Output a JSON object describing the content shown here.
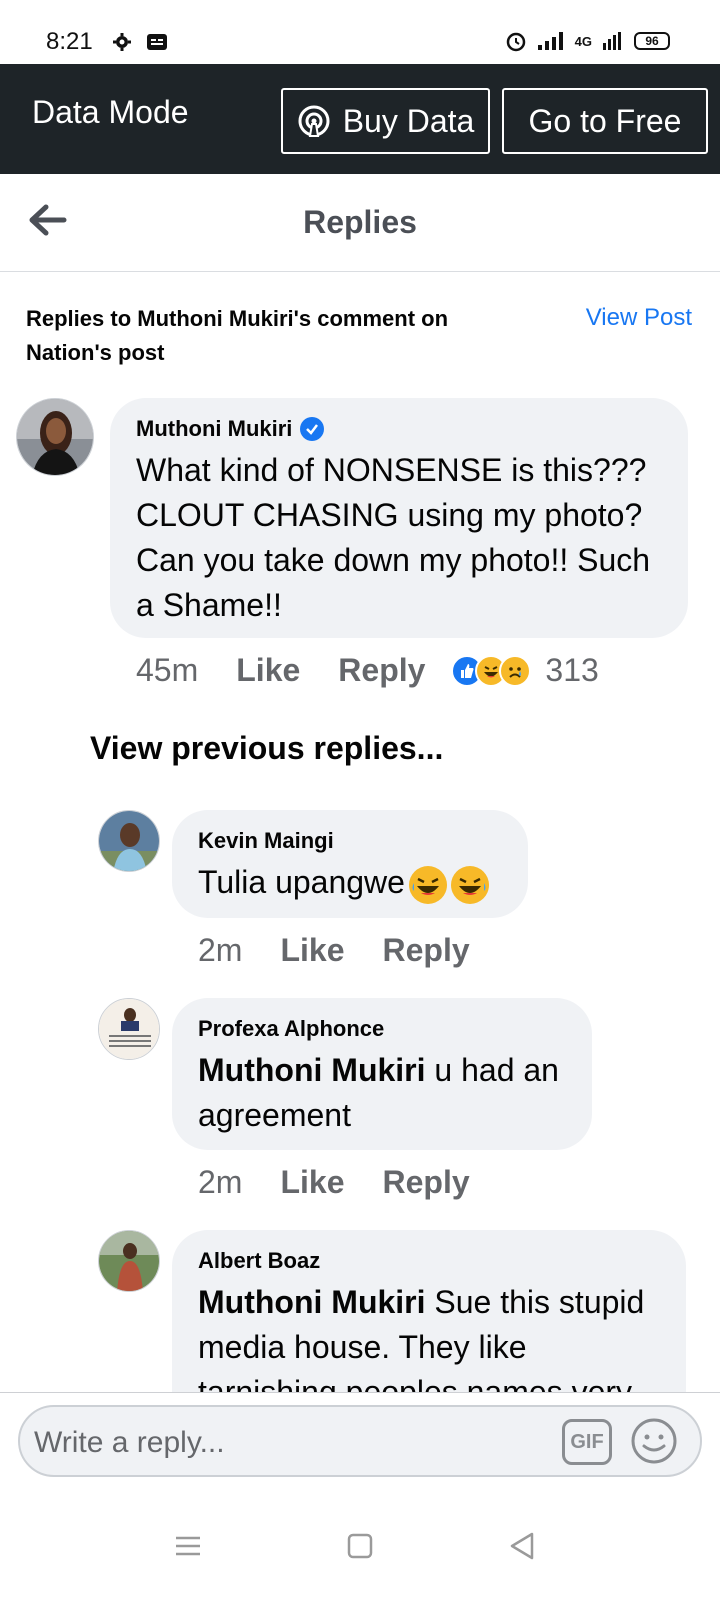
{
  "status_bar": {
    "time": "8:21",
    "network": "4G",
    "battery": "96"
  },
  "data_mode": {
    "title": "Data Mode",
    "buy_label": "Buy Data",
    "free_label": "Go to Free"
  },
  "header": {
    "title": "Replies"
  },
  "subheader": {
    "title": "Replies to Muthoni  Mukiri's comment on Nation's post",
    "view_post": "View Post"
  },
  "main_comment": {
    "author": "Muthoni  Mukiri",
    "verified": true,
    "text": "What kind of NONSENSE is this??? CLOUT CHASING using my photo? Can you take down my photo!! Such a Shame!!",
    "time": "45m",
    "like": "Like",
    "reply": "Reply",
    "reactions": [
      "like",
      "haha",
      "sad"
    ],
    "reaction_count": "313"
  },
  "view_previous": "View previous replies...",
  "replies": [
    {
      "author": "Kevin Maingi",
      "mention": "",
      "text": "Tulia upangwe",
      "time": "2m",
      "like": "Like",
      "reply": "Reply"
    },
    {
      "author": "Profexa Alphonce",
      "mention": "Muthoni  Mukiri",
      "text": " u had an agreement",
      "time": "2m",
      "like": "Like",
      "reply": "Reply"
    },
    {
      "author": "Albert Boaz",
      "mention": "Muthoni  Mukiri",
      "text": " Sue this stupid media house. They like tarnishing peoples names very"
    }
  ],
  "composer": {
    "placeholder": "Write a reply...",
    "gif_label": "GIF"
  },
  "colors": {
    "accent": "#1877f2",
    "dark_bar": "#1e2428",
    "bubble": "#f0f2f5",
    "meta_text": "#65676b"
  }
}
